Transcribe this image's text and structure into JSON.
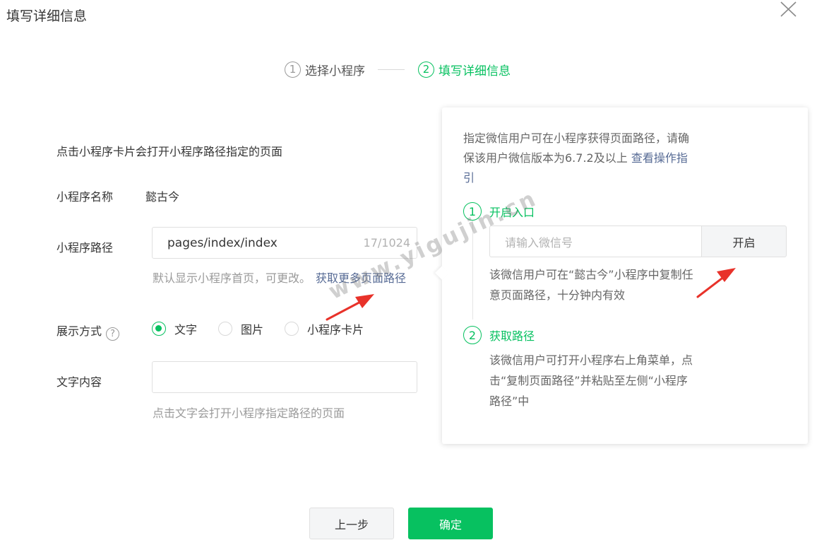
{
  "dialog": {
    "title": "填写详细信息"
  },
  "steps": [
    {
      "num": "1",
      "label": "选择小程序"
    },
    {
      "num": "2",
      "label": "填写详细信息"
    }
  ],
  "form": {
    "description": "点击小程序卡片会打开小程序路径指定的页面",
    "name_label": "小程序名称",
    "name_value": "懿古今",
    "path_label": "小程序路径",
    "path_value": "pages/index/index",
    "path_count": "17/1024",
    "path_hint": "默认显示小程序首页，可更改。",
    "path_link": "获取更多页面路径",
    "display_label": "展示方式",
    "help_icon": "?",
    "display_options": [
      "文字",
      "图片",
      "小程序卡片"
    ],
    "display_selected": "文字",
    "text_label": "文字内容",
    "text_hint": "点击文字会打开小程序指定路径的页面"
  },
  "buttons": {
    "prev": "上一步",
    "confirm": "确定"
  },
  "popover": {
    "intro_text": "指定微信用户可在小程序获得页面路径，请确保该用户微信版本为6.7.2及以上",
    "intro_link": "查看操作指引",
    "step1_num": "1",
    "step1_title": "开启入口",
    "wechat_placeholder": "请输入微信号",
    "enable_button": "开启",
    "step1_note": "该微信用户可在“懿古今”小程序中复制任意页面路径，十分钟内有效",
    "step2_num": "2",
    "step2_title": "获取路径",
    "step2_note": "该微信用户可打开小程序右上角菜单，点击“复制页面路径”并粘贴至左侧“小程序路径”中"
  },
  "watermark": "www.yigujin.cn",
  "colors": {
    "accent": "#07c160",
    "link": "#576b95",
    "annotation": "#e8322a"
  }
}
